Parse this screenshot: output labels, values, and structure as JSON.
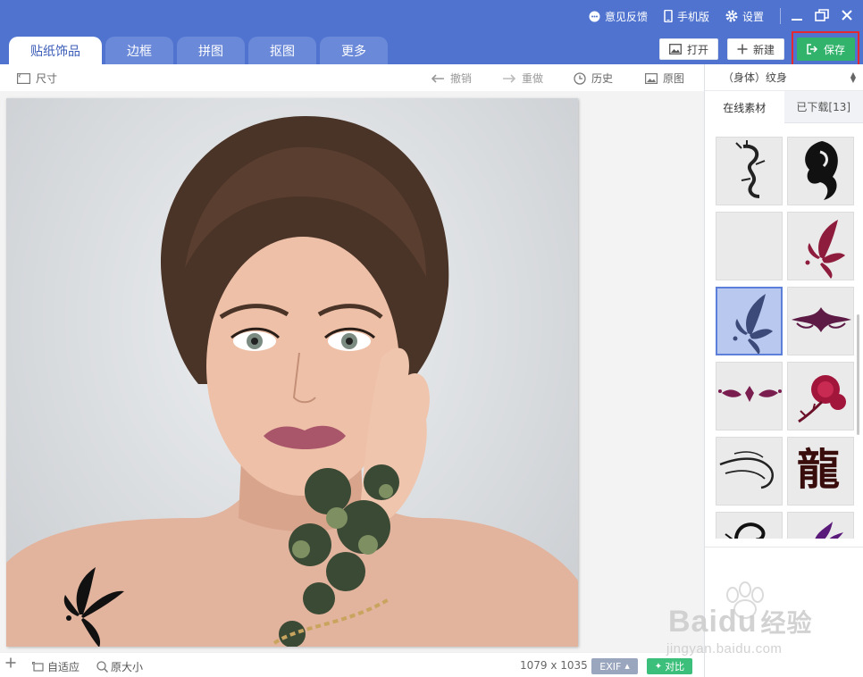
{
  "topbar": {
    "feedback_label": "意见反馈",
    "mobile_label": "手机版",
    "settings_label": "设置"
  },
  "tabs": [
    {
      "label": "贴纸饰品",
      "active": true
    },
    {
      "label": "边框"
    },
    {
      "label": "拼图"
    },
    {
      "label": "抠图"
    },
    {
      "label": "更多"
    }
  ],
  "actions": {
    "open_label": "打开",
    "new_label": "新建",
    "save_label": "保存"
  },
  "toolbar": {
    "size_label": "尺寸",
    "undo_label": "撤销",
    "redo_label": "重做",
    "history_label": "历史",
    "original_label": "原图"
  },
  "statusbar": {
    "fit_label": "自适应",
    "actual_size_label": "原大小",
    "dimensions": "1079 x 1035",
    "exif_label": "EXIF",
    "compare_label": "对比"
  },
  "panel": {
    "category": "（身体）纹身",
    "tab_online": "在线素材",
    "tab_downloaded": "已下载[13]",
    "thumbnails": [
      {
        "icon": "dragon-tattoo-icon"
      },
      {
        "icon": "tribal-dragon-tattoo-icon"
      },
      {
        "icon": "empty-thumbnail"
      },
      {
        "icon": "red-butterfly-tattoo-icon"
      },
      {
        "icon": "blue-butterfly-tattoo-icon",
        "selected": true
      },
      {
        "icon": "tribal-band-tattoo-icon"
      },
      {
        "icon": "tribal-ornament-tattoo-icon"
      },
      {
        "icon": "rose-tattoo-icon"
      },
      {
        "icon": "swirl-tattoo-icon"
      },
      {
        "icon": "dragon-character-tattoo-icon",
        "text": "龍"
      },
      {
        "icon": "scorpion-tattoo-icon"
      },
      {
        "icon": "purple-flame-tattoo-icon"
      }
    ]
  },
  "watermark": {
    "brand": "Bai",
    "brand2": "du",
    "cn": "经验",
    "url": "jingyan.baidu.com"
  },
  "colors": {
    "titlebar": "#4f73cf",
    "tab_inactive": "#6a89d8",
    "save": "#31b36b",
    "highlight": "#e5282f",
    "selected_thumb": "#b9c8ee"
  }
}
